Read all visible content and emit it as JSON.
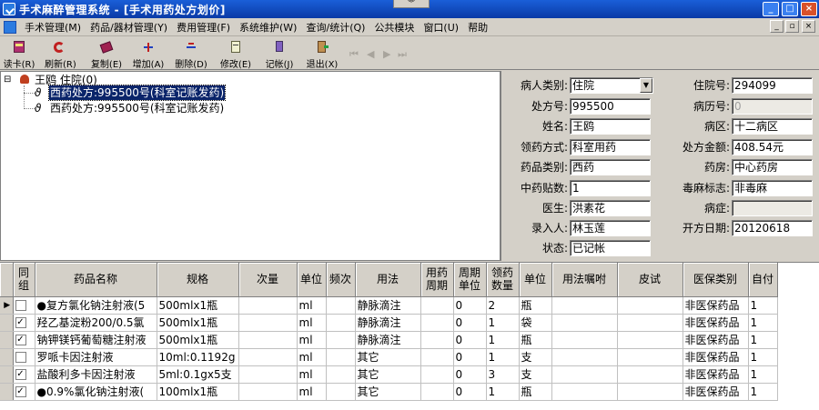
{
  "window": {
    "title": "手术麻醉管理系统 - [手术用药处方划价]",
    "collapse": "︾",
    "min": "_",
    "max": "□",
    "close": "×",
    "mdi_min": "_",
    "mdi_restore": "▫",
    "mdi_close": "×"
  },
  "menu": [
    "手术管理(M)",
    "药品/器材管理(Y)",
    "费用管理(F)",
    "系统维护(W)",
    "查询/统计(Q)",
    "公共模块",
    "窗口(U)",
    "帮助"
  ],
  "toolbar": [
    "读卡(R)",
    "刷新(R)",
    "复制(E)",
    "增加(A)",
    "删除(D)",
    "修改(E)",
    "记帐(J)",
    "退出(X)"
  ],
  "nav": [
    "⏮",
    "◀",
    "▶",
    "⏭"
  ],
  "tree": {
    "expander": "⊟",
    "root": "王鸥 住院(0)",
    "items": [
      "西药处方:995500号(科室记账发药)",
      "西药处方:995500号(科室记账发药)"
    ]
  },
  "form": {
    "labels": {
      "patient_type": "病人类别:",
      "inpatient_no": "住院号:",
      "rx_no": "处方号:",
      "record_no": "病历号:",
      "name": "姓名:",
      "ward": "病区:",
      "dispense_method": "领药方式:",
      "rx_amount": "处方金额:",
      "drug_type": "药品类别:",
      "pharmacy": "药房:",
      "herbal_doses": "中药贴数:",
      "narcotic_flag": "毒麻标志:",
      "doctor": "医生:",
      "symptom": "病症:",
      "entered_by": "录入人:",
      "rx_date": "开方日期:",
      "status": "状态:"
    },
    "values": {
      "patient_type": "住院",
      "inpatient_no": "294099",
      "rx_no": "995500",
      "record_no": "0",
      "name": "王鸥",
      "ward": "十二病区",
      "dispense_method": "科室用药",
      "rx_amount": "408.54元",
      "drug_type": "西药",
      "pharmacy": "中心药房",
      "herbal_doses": "1",
      "narcotic_flag": "非毒麻",
      "doctor": "洪素花",
      "symptom": "",
      "entered_by": "林玉莲",
      "rx_date": "20120618",
      "status": "已记帐"
    }
  },
  "grid": {
    "headers": [
      "同组",
      "药品名称",
      "规格",
      "次量",
      "单位",
      "频次",
      "用法",
      "用药周期",
      "周期单位",
      "领药数量",
      "单位",
      "用法嘱咐",
      "皮试",
      "医保类别",
      "自付"
    ],
    "rows": [
      {
        "indicator": "▶",
        "group": false,
        "name": "●复方氯化钠注射液(5",
        "spec": "500mlx1瓶",
        "dose": "",
        "unit": "ml",
        "freq": "",
        "usage": "静脉滴注",
        "period": "",
        "period_unit": "0",
        "qty": "2",
        "qty_unit": "瓶",
        "note": "",
        "skin": "",
        "ins": "非医保药品",
        "self": "1"
      },
      {
        "indicator": "",
        "group": true,
        "name": "羟乙基淀粉200/0.5氯",
        "spec": "500mlx1瓶",
        "dose": "",
        "unit": "ml",
        "freq": "",
        "usage": "静脉滴注",
        "period": "",
        "period_unit": "0",
        "qty": "1",
        "qty_unit": "袋",
        "note": "",
        "skin": "",
        "ins": "非医保药品",
        "self": "1"
      },
      {
        "indicator": "",
        "group": true,
        "name": "钠钾镁钙葡萄糖注射液",
        "spec": "500mlx1瓶",
        "dose": "",
        "unit": "ml",
        "freq": "",
        "usage": "静脉滴注",
        "period": "",
        "period_unit": "0",
        "qty": "1",
        "qty_unit": "瓶",
        "note": "",
        "skin": "",
        "ins": "非医保药品",
        "self": "1"
      },
      {
        "indicator": "",
        "group": false,
        "name": "罗哌卡因注射液",
        "spec": "10ml:0.1192g",
        "dose": "",
        "unit": "ml",
        "freq": "",
        "usage": "其它",
        "period": "",
        "period_unit": "0",
        "qty": "1",
        "qty_unit": "支",
        "note": "",
        "skin": "",
        "ins": "非医保药品",
        "self": "1"
      },
      {
        "indicator": "",
        "group": true,
        "name": "盐酸利多卡因注射液",
        "spec": "5ml:0.1gx5支",
        "dose": "",
        "unit": "ml",
        "freq": "",
        "usage": "其它",
        "period": "",
        "period_unit": "0",
        "qty": "3",
        "qty_unit": "支",
        "note": "",
        "skin": "",
        "ins": "非医保药品",
        "self": "1"
      },
      {
        "indicator": "",
        "group": true,
        "name": "●0.9%氯化钠注射液(",
        "spec": "100mlx1瓶",
        "dose": "",
        "unit": "ml",
        "freq": "",
        "usage": "其它",
        "period": "",
        "period_unit": "0",
        "qty": "1",
        "qty_unit": "瓶",
        "note": "",
        "skin": "",
        "ins": "非医保药品",
        "self": "1"
      }
    ]
  },
  "colors": {
    "title_bar": "#0a3aa6",
    "selection": "#0a246a",
    "chrome": "#d4d0c8"
  }
}
